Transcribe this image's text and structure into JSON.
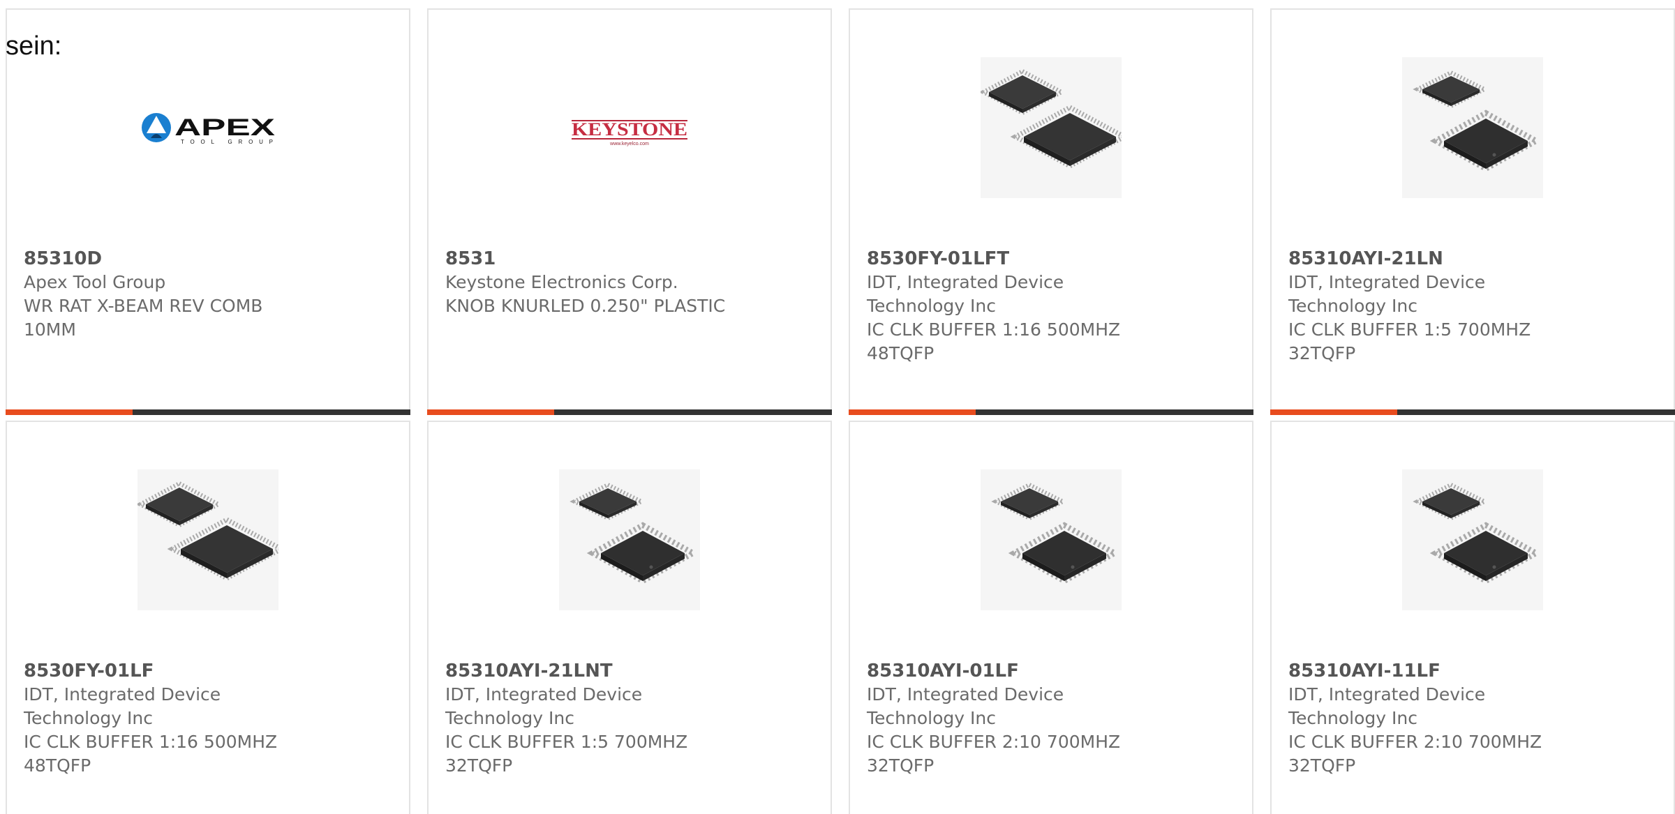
{
  "intro": {
    "text": "sein:"
  },
  "colors": {
    "accent": "#e84c1e",
    "bar": "#333333",
    "border": "#e3e3e3",
    "text": "#6a6a6a"
  },
  "products": [
    {
      "part_number": "85310D",
      "manufacturer": "Apex Tool Group",
      "description": "WR RAT X-BEAM REV COMB 10MM",
      "image": "apex-tool-group-logo",
      "logo_text": "APEX",
      "logo_subtext": "TOOL GROUP"
    },
    {
      "part_number": "8531",
      "manufacturer": "Keystone Electronics Corp.",
      "description": "KNOB KNURLED 0.250\" PLASTIC",
      "image": "keystone-logo",
      "logo_text": "KEYSTONE",
      "logo_subtext": "www.keyelco.com"
    },
    {
      "part_number": "8530FY-01LFT",
      "manufacturer": "IDT, Integrated Device Technology Inc",
      "description": "IC CLK BUFFER 1:16 500MHZ 48TQFP",
      "image": "ic-chip-48tqfp"
    },
    {
      "part_number": "85310AYI-21LN",
      "manufacturer": "IDT, Integrated Device Technology Inc",
      "description": "IC CLK BUFFER 1:5 700MHZ 32TQFP",
      "image": "ic-chip-32tqfp"
    },
    {
      "part_number": "8530FY-01LF",
      "manufacturer": "IDT, Integrated Device Technology Inc",
      "description": "IC CLK BUFFER 1:16 500MHZ 48TQFP",
      "image": "ic-chip-48tqfp"
    },
    {
      "part_number": "85310AYI-21LNT",
      "manufacturer": "IDT, Integrated Device Technology Inc",
      "description": "IC CLK BUFFER 1:5 700MHZ 32TQFP",
      "image": "ic-chip-32tqfp"
    },
    {
      "part_number": "85310AYI-01LF",
      "manufacturer": "IDT, Integrated Device Technology Inc",
      "description": "IC CLK BUFFER 2:10 700MHZ 32TQFP",
      "image": "ic-chip-32tqfp"
    },
    {
      "part_number": "85310AYI-11LF",
      "manufacturer": "IDT, Integrated Device Technology Inc",
      "description": "IC CLK BUFFER 2:10 700MHZ 32TQFP",
      "image": "ic-chip-32tqfp"
    }
  ]
}
